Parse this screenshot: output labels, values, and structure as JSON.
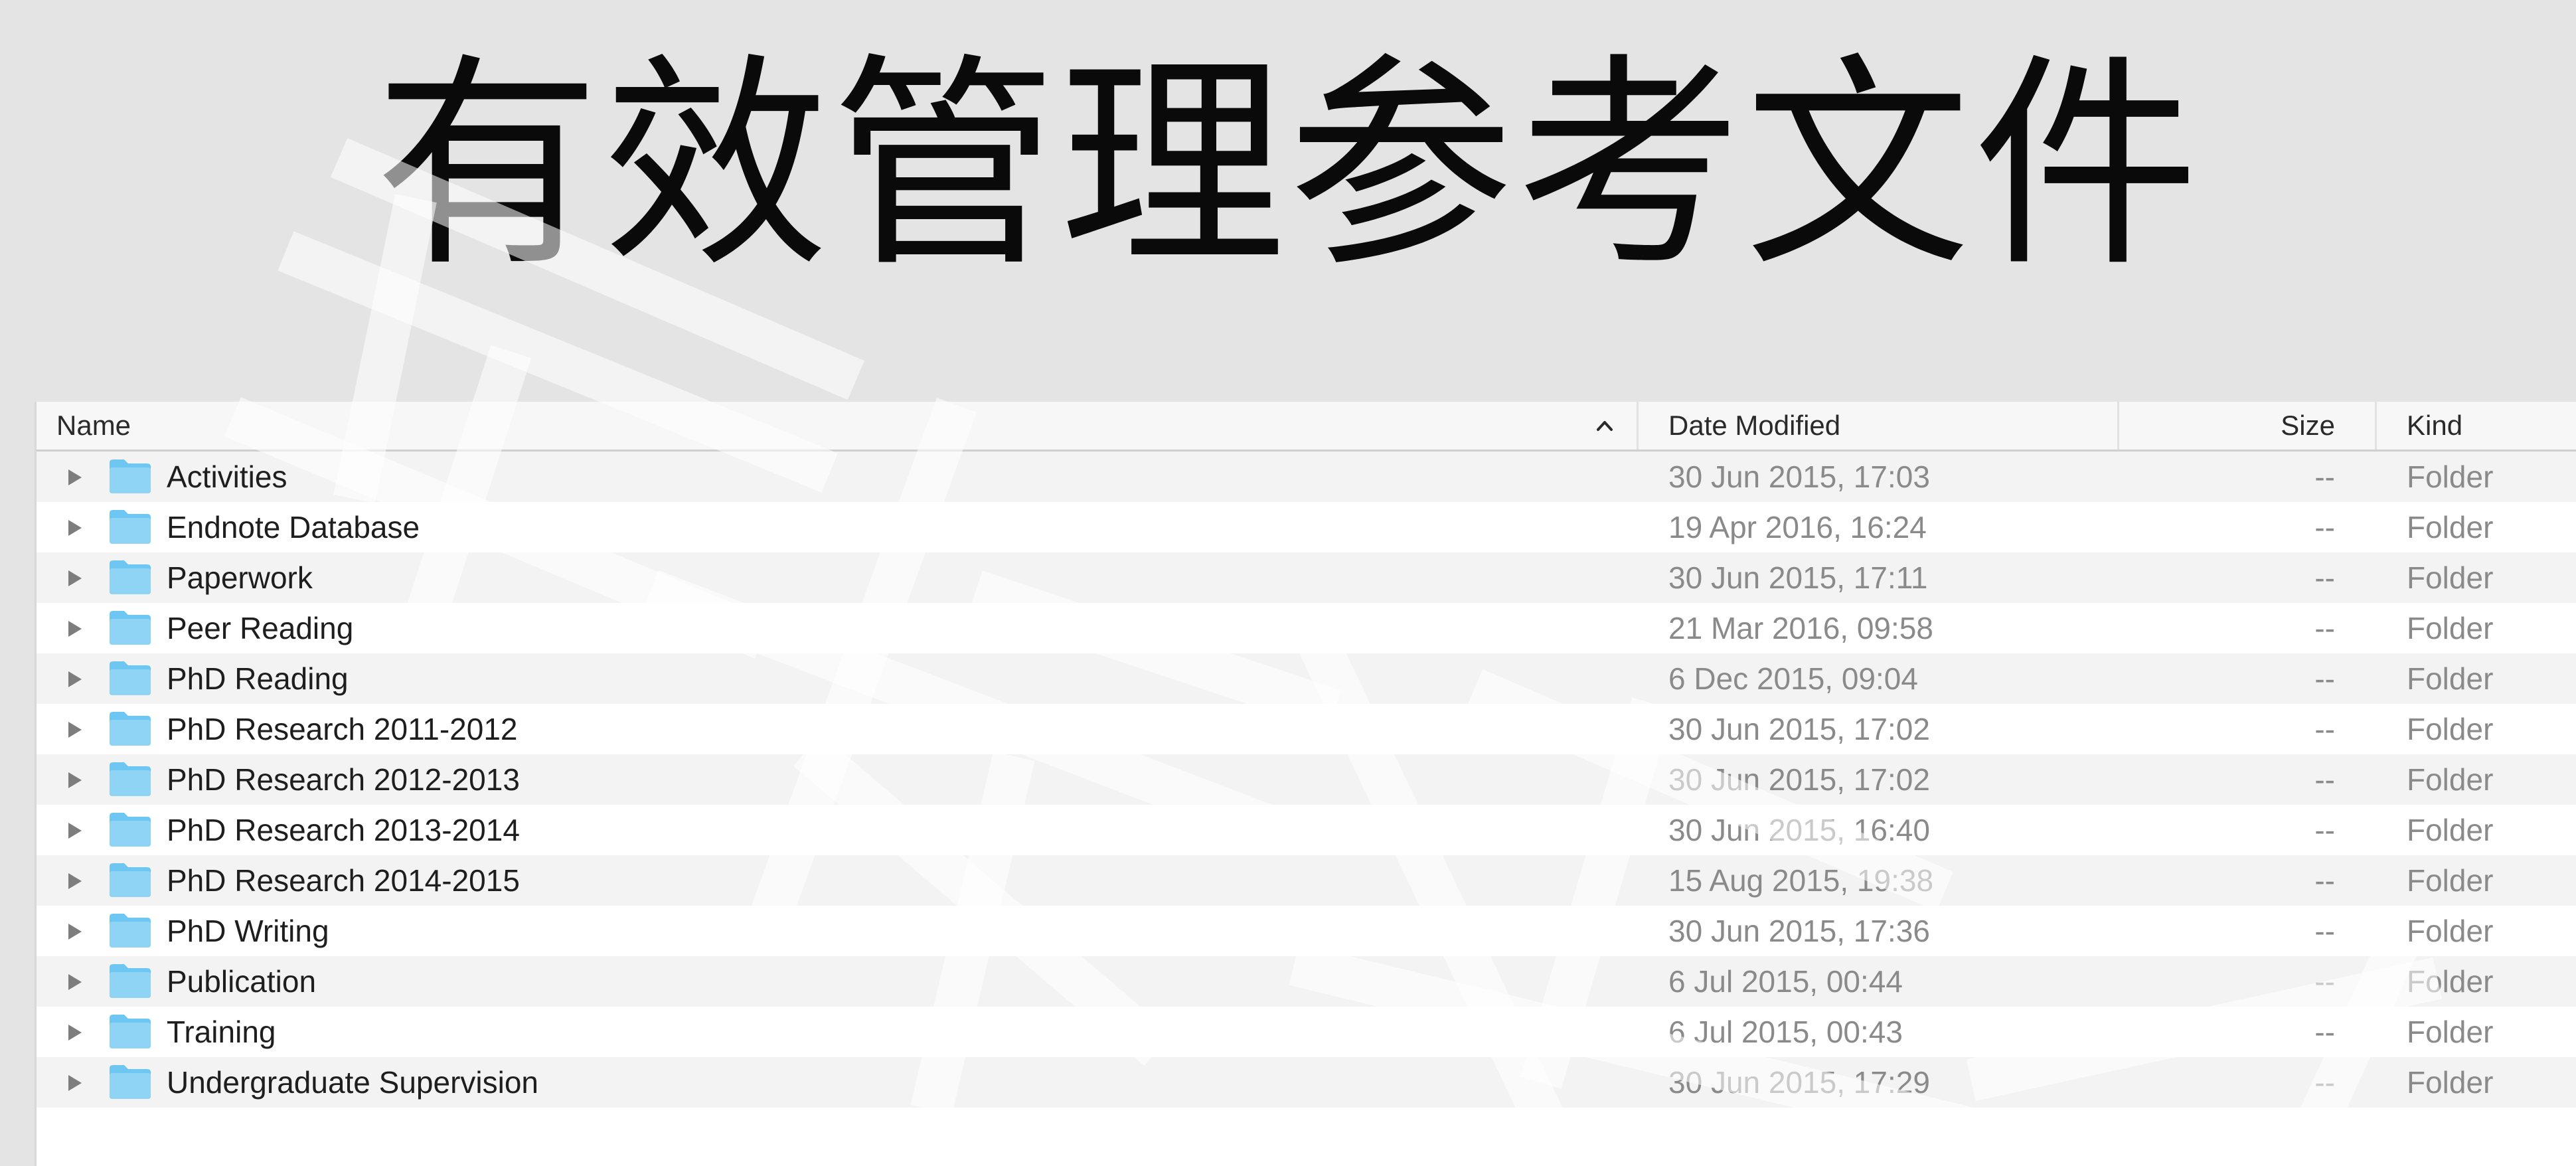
{
  "slide": {
    "title": "有效管理参考文件"
  },
  "columns": {
    "name": "Name",
    "date_modified": "Date Modified",
    "size": "Size",
    "kind": "Kind"
  },
  "sort_icon": "chevron-up-icon",
  "row_icons": {
    "disclosure": "disclosure-triangle-icon",
    "folder": "folder-icon"
  },
  "rows": [
    {
      "name": "Activities",
      "date": "30 Jun 2015, 17:03",
      "size": "--",
      "kind": "Folder"
    },
    {
      "name": "Endnote Database",
      "date": "19 Apr 2016, 16:24",
      "size": "--",
      "kind": "Folder"
    },
    {
      "name": "Paperwork",
      "date": "30 Jun 2015, 17:11",
      "size": "--",
      "kind": "Folder"
    },
    {
      "name": "Peer Reading",
      "date": "21 Mar 2016, 09:58",
      "size": "--",
      "kind": "Folder"
    },
    {
      "name": "PhD Reading",
      "date": "6 Dec 2015, 09:04",
      "size": "--",
      "kind": "Folder"
    },
    {
      "name": "PhD Research 2011-2012",
      "date": "30 Jun 2015, 17:02",
      "size": "--",
      "kind": "Folder"
    },
    {
      "name": "PhD Research 2012-2013",
      "date": "30 Jun 2015, 17:02",
      "size": "--",
      "kind": "Folder"
    },
    {
      "name": "PhD Research 2013-2014",
      "date": "30 Jun 2015, 16:40",
      "size": "--",
      "kind": "Folder"
    },
    {
      "name": "PhD Research 2014-2015",
      "date": "15 Aug 2015, 19:38",
      "size": "--",
      "kind": "Folder"
    },
    {
      "name": "PhD Writing",
      "date": "30 Jun 2015, 17:36",
      "size": "--",
      "kind": "Folder"
    },
    {
      "name": "Publication",
      "date": "6 Jul 2015, 00:44",
      "size": "--",
      "kind": "Folder"
    },
    {
      "name": "Training",
      "date": "6 Jul 2015, 00:43",
      "size": "--",
      "kind": "Folder"
    },
    {
      "name": "Undergraduate Supervision",
      "date": "30 Jun 2015, 17:29",
      "size": "--",
      "kind": "Folder"
    }
  ],
  "colors": {
    "folder": "#6ec7f2",
    "folder_tab": "#8fd4f5",
    "page_background": "#e4e4e4",
    "secondary_text": "#8a8a8a"
  }
}
